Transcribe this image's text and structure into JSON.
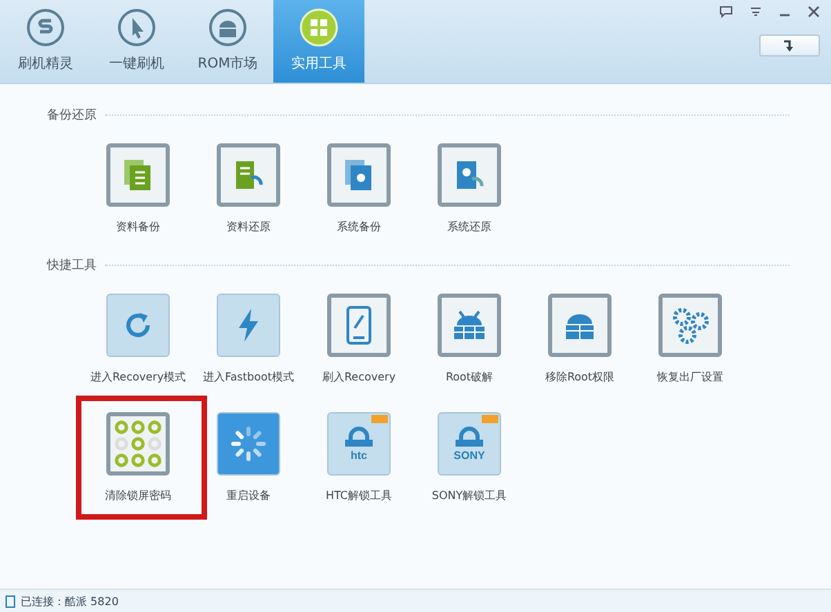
{
  "tabs": [
    {
      "label": "刷机精灵",
      "selected": false
    },
    {
      "label": "一键刷机",
      "selected": false
    },
    {
      "label": "ROM市场",
      "selected": false
    },
    {
      "label": "实用工具",
      "selected": true
    }
  ],
  "sections": [
    {
      "title": "备份还原",
      "rows": [
        [
          {
            "label": "资料备份",
            "kind": "outlined",
            "highlighted": false,
            "badge": false
          },
          {
            "label": "资料还原",
            "kind": "outlined",
            "highlighted": false,
            "badge": false
          },
          {
            "label": "系统备份",
            "kind": "outlined",
            "highlighted": false,
            "badge": false
          },
          {
            "label": "系统还原",
            "kind": "outlined",
            "highlighted": false,
            "badge": false
          }
        ]
      ]
    },
    {
      "title": "快捷工具",
      "rows": [
        [
          {
            "label": "进入Recovery模式",
            "kind": "filled",
            "highlighted": false,
            "badge": false
          },
          {
            "label": "进入Fastboot模式",
            "kind": "filled",
            "highlighted": false,
            "badge": false
          },
          {
            "label": "刷入Recovery",
            "kind": "outlined",
            "highlighted": false,
            "badge": false
          },
          {
            "label": "Root破解",
            "kind": "outlined",
            "highlighted": false,
            "badge": false
          },
          {
            "label": "移除Root权限",
            "kind": "outlined",
            "highlighted": false,
            "badge": false
          },
          {
            "label": "恢复出厂设置",
            "kind": "outlined",
            "highlighted": false,
            "badge": false
          }
        ],
        [
          {
            "label": "清除锁屏密码",
            "kind": "outlined",
            "highlighted": true,
            "badge": false
          },
          {
            "label": "重启设备",
            "kind": "solid",
            "highlighted": false,
            "badge": false
          },
          {
            "label": "HTC解锁工具",
            "kind": "filled",
            "highlighted": false,
            "badge": true,
            "logo_text": "htc"
          },
          {
            "label": "SONY解锁工具",
            "kind": "filled",
            "highlighted": false,
            "badge": true,
            "logo_text": "SONY"
          }
        ]
      ]
    }
  ],
  "status_bar": {
    "text": "已连接：酷派 5820"
  }
}
